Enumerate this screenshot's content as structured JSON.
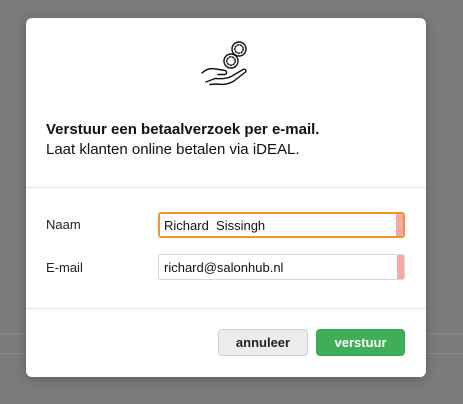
{
  "dialog": {
    "icon": "hand-with-coins-icon",
    "title": "Verstuur een betaalverzoek per e-mail.",
    "subtitle": "Laat klanten online betalen via iDEAL.",
    "fields": {
      "name_label": "Naam",
      "name_value": "Richard  Sissingh",
      "email_label": "E-mail",
      "email_value": "richard@salonhub.nl"
    },
    "buttons": {
      "cancel_label": "annuleer",
      "send_label": "verstuur"
    }
  },
  "colors": {
    "focus_border": "#f0932b",
    "send_button": "#3fae5a",
    "field_flag": "#f4a9a9",
    "backdrop": "#7b7b7b"
  }
}
